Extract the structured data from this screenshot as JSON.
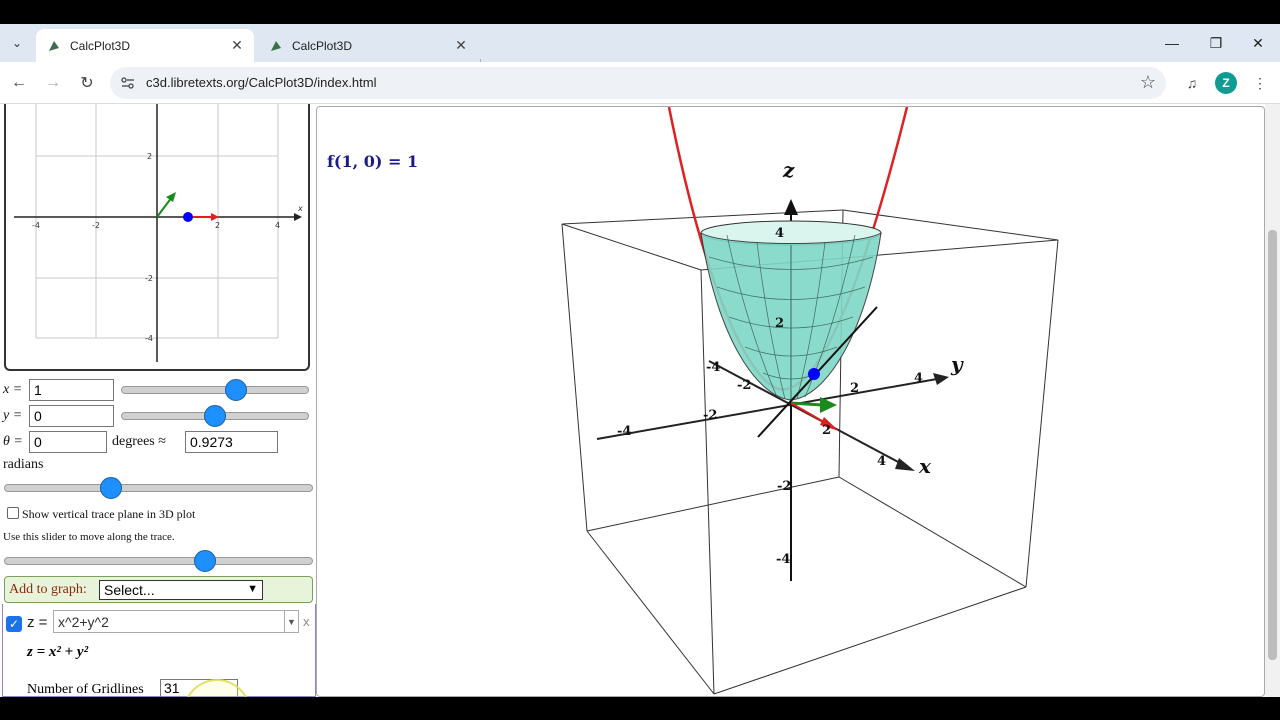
{
  "browser": {
    "tabs": [
      {
        "title": "CalcPlot3D",
        "active": true
      },
      {
        "title": "CalcPlot3D",
        "active": false
      }
    ],
    "url": "c3d.libretexts.org/CalcPlot3D/index.html",
    "profile_initial": "Z"
  },
  "plot2d": {
    "ticks_x": [
      "-4",
      "-2",
      "2",
      "4"
    ],
    "ticks_y": [
      "2",
      "-2",
      "-4"
    ],
    "axis_x_label": "x"
  },
  "controls": {
    "x_label": "x =",
    "x_value": "1",
    "x_slider": 0.6,
    "y_label": "y =",
    "y_value": "0",
    "y_slider": 0.5,
    "theta_label": "θ =",
    "theta_value": "0",
    "degrees_label": "degrees ≈",
    "radians_value": "0.9273",
    "radians_label": "radians",
    "theta_slider": 0.35,
    "trace_plane_label": "Show vertical trace plane in 3D plot",
    "trace_slider_hint": "Use this slider to move along the trace.",
    "trace_slider": 0.65
  },
  "add_graph": {
    "label": "Add to graph:",
    "select_value": "Select..."
  },
  "function": {
    "lhs": "z =",
    "input": "x^2+y^2",
    "remove": "x",
    "rendered": "z = x² + y²",
    "gridlines_label": "Number of Gridlines",
    "gridlines_value": "31"
  },
  "plot3d": {
    "title": "f(1, 0) = 1",
    "axis_labels": {
      "x": "x",
      "y": "y",
      "z": "z"
    },
    "ticks_z": [
      "4",
      "2",
      "-2",
      "-4"
    ],
    "ticks_y": [
      "-4",
      "-2",
      "2",
      "4"
    ],
    "ticks_x": [
      "-4",
      "-2",
      "2",
      "4"
    ],
    "colors": {
      "curve": "#e02020",
      "surface": "#7fd8c8",
      "point": "#0000ff",
      "gradient_arrow": "#1a8a1a",
      "direction_arrow": "#e02020"
    }
  }
}
